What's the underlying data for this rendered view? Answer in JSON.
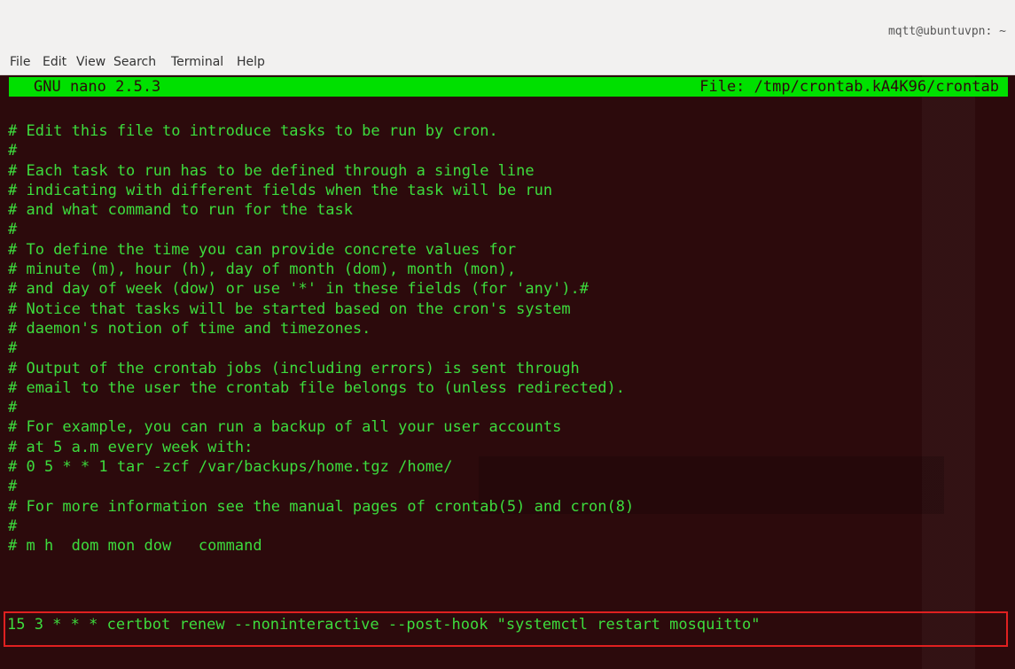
{
  "window": {
    "title": "mqtt@ubuntuvpn: ~"
  },
  "menubar": {
    "items": [
      "File",
      "Edit",
      "View",
      "Search",
      "Terminal",
      "Help"
    ]
  },
  "nano": {
    "version": "GNU nano 2.5.3",
    "file_label": "File: /tmp/crontab.kA4K96/crontab"
  },
  "content": {
    "lines": [
      "# Edit this file to introduce tasks to be run by cron.",
      "#",
      "# Each task to run has to be defined through a single line",
      "# indicating with different fields when the task will be run",
      "# and what command to run for the task",
      "#",
      "# To define the time you can provide concrete values for",
      "# minute (m), hour (h), day of month (dom), month (mon),",
      "# and day of week (dow) or use '*' in these fields (for 'any').#",
      "# Notice that tasks will be started based on the cron's system",
      "# daemon's notion of time and timezones.",
      "#",
      "# Output of the crontab jobs (including errors) is sent through",
      "# email to the user the crontab file belongs to (unless redirected).",
      "#",
      "# For example, you can run a backup of all your user accounts",
      "# at 5 a.m every week with:",
      "# 0 5 * * 1 tar -zcf /var/backups/home.tgz /home/",
      "#",
      "# For more information see the manual pages of crontab(5) and cron(8)",
      "#",
      "# m h  dom mon dow   command"
    ],
    "command_line": "15 3 * * * certbot renew --noninteractive --post-hook \"systemctl restart mosquitto\""
  },
  "colors": {
    "terminal_bg": "#2c0a0c",
    "terminal_fg": "#3ddc3d",
    "header_bg": "#00e000",
    "highlight_border": "#e02020"
  }
}
